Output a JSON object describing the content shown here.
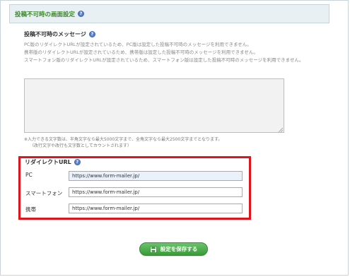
{
  "section": {
    "title": "投稿不可時の画面設定"
  },
  "message": {
    "label": "投稿不可時のメッセージ",
    "notice_lines": [
      "PC版のリダイレクトURLが設定されているため、PC版は設定した投稿不可時のメッセージを利用できません。",
      "携帯版のリダイレクトURLが設定されているため、携帯版は設定した投稿不可時のメッセージを利用できません。",
      "スマートフォン版のリダイレクトURLが設定されているため、スマートフォン版は設定した投稿不可時のメッセージを利用できません。"
    ],
    "textarea_value": "",
    "char_note_line1": "※入力できる文字数は、半角文字なら最大5000文字まで、全角文字なら最大2500文字までとなります。",
    "char_note_line2": "（改行文字や改行も文字数としてカウントされます）"
  },
  "redirect": {
    "title": "リダイレクトURL",
    "rows": [
      {
        "label": "PC",
        "value": "https://www.form-mailer.jp/"
      },
      {
        "label": "スマートフォン",
        "value": "https://www.form-mailer.jp/"
      },
      {
        "label": "携帯",
        "value": "https://www.form-mailer.jp/"
      }
    ]
  },
  "save_button": {
    "label": "設定を保存する"
  },
  "help_icon_glyph": "?",
  "colors": {
    "title_green": "#3a8a28",
    "highlight_red": "#e0141c",
    "button_green": "#3a9a3a",
    "help_blue": "#5a7fc9"
  }
}
